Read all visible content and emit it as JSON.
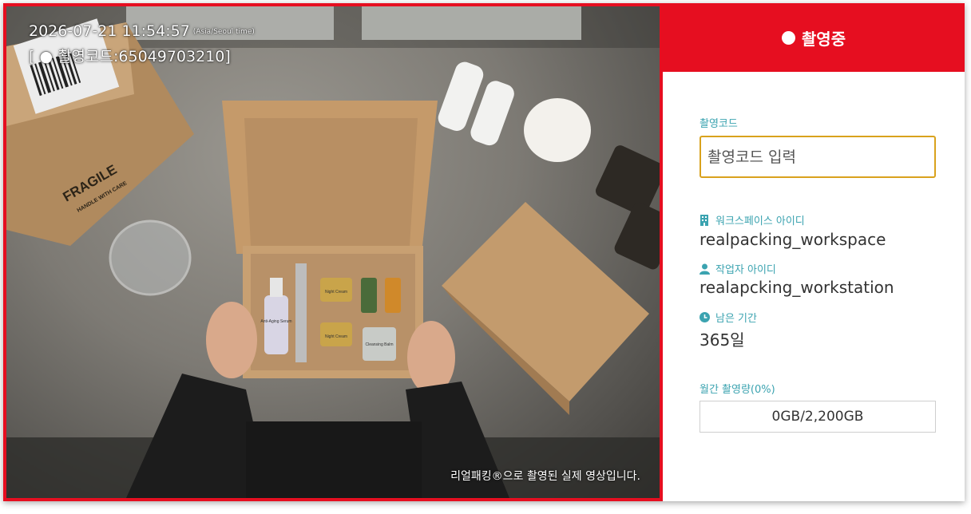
{
  "video": {
    "timestamp": "2026-07-21 11:54:57",
    "timezone": "(Asia/Seoul time)",
    "code_overlay": "[ ● 촬영코드:65049703210]",
    "caption": "리얼패킹®으로 촬영된 실제 영상입니다.",
    "scene_labels": {
      "fragile": "FRAGILE",
      "handle": "HANDLE WITH CARE",
      "serum": "Anti-Aging Serum",
      "night_cream_1": "Night Cream",
      "night_cream_2": "Night Cream",
      "balm": "Cleansing Balm"
    }
  },
  "panel": {
    "status": "촬영중",
    "code_label": "촬영코드",
    "code_placeholder": "촬영코드 입력",
    "workspace_label": "워크스페이스 아이디",
    "workspace_value": "realpacking_workspace",
    "worker_label": "작업자 아이디",
    "worker_value": "realapcking_workstation",
    "remaining_label": "남은 기간",
    "remaining_value": "365일",
    "usage_label": "월간 촬영량(0%)",
    "usage_value": "0GB/2,200GB"
  },
  "colors": {
    "accent_red": "#e60e20",
    "label_teal": "#3ba3b0",
    "input_border": "#d9a21d"
  },
  "icons": {
    "status": "record-dot-icon",
    "workspace": "building-icon",
    "worker": "person-icon",
    "remaining": "clock-icon"
  }
}
